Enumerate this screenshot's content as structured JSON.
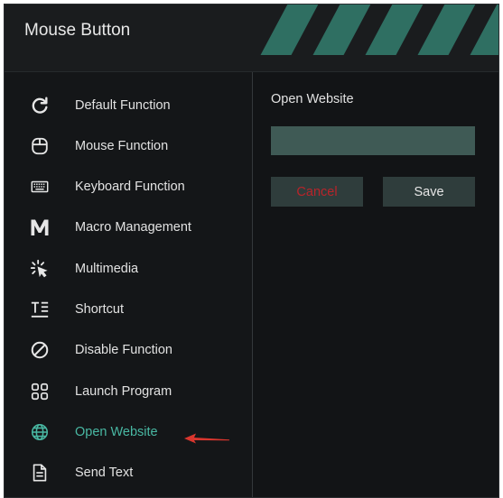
{
  "window": {
    "title": "Mouse Button"
  },
  "colors": {
    "accent": "#49b8a3",
    "stripe": "#2f6f62",
    "cancel_text": "#b9242a",
    "input_bg": "#3f5a55",
    "button_bg": "#2f3d3c"
  },
  "sidebar": {
    "items": [
      {
        "label": "Default Function",
        "icon": "refresh-icon"
      },
      {
        "label": "Mouse Function",
        "icon": "mouse-icon"
      },
      {
        "label": "Keyboard Function",
        "icon": "keyboard-icon"
      },
      {
        "label": "Macro Management",
        "icon": "macro-m-icon"
      },
      {
        "label": "Multimedia",
        "icon": "cursor-sparkle-icon"
      },
      {
        "label": "Shortcut",
        "icon": "shortcut-text-icon"
      },
      {
        "label": "Disable Function",
        "icon": "disable-icon"
      },
      {
        "label": "Launch Program",
        "icon": "grid-apps-icon"
      },
      {
        "label": "Open Website",
        "icon": "globe-icon",
        "active": true
      },
      {
        "label": "Send Text",
        "icon": "document-icon"
      }
    ]
  },
  "main": {
    "section_title": "Open Website",
    "url_input": {
      "value": "",
      "placeholder": ""
    },
    "cancel_label": "Cancel",
    "save_label": "Save"
  }
}
